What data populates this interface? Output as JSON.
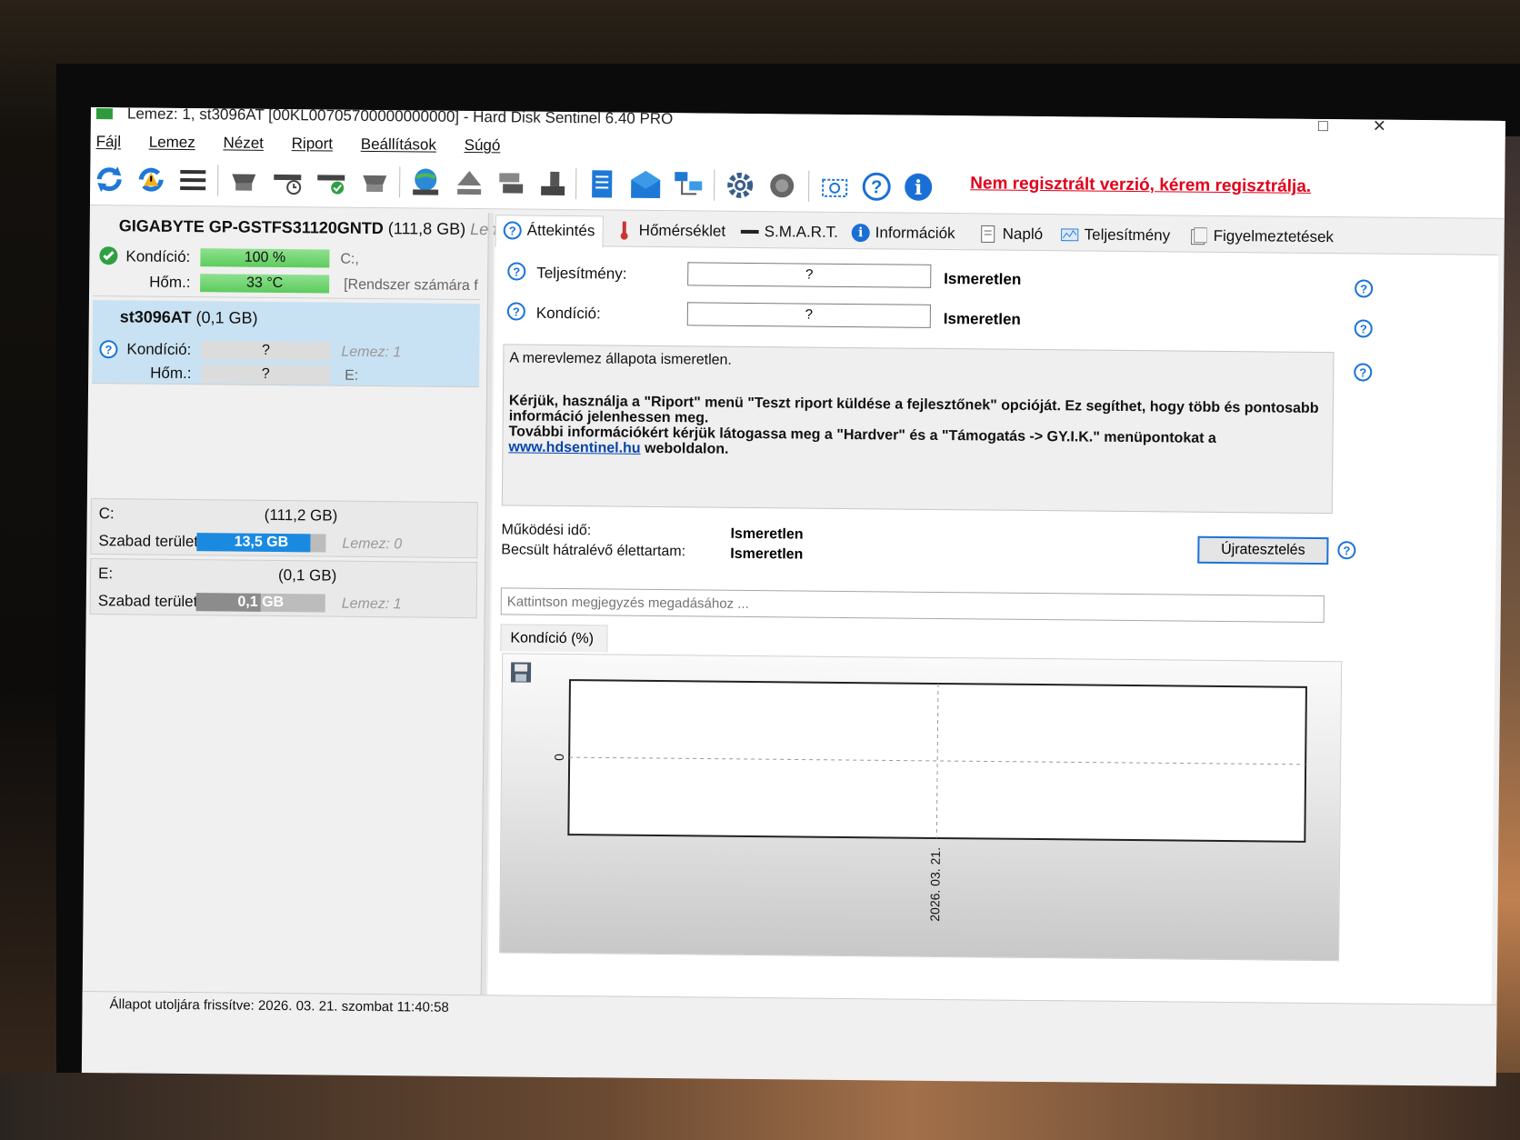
{
  "window": {
    "title": "Lemez: 1, st3096AT [00KL00705700000000000] - Hard Disk Sentinel 6.40 PRO",
    "minimize_glyph": "–",
    "maximize_glyph": "□",
    "close_glyph": "✕"
  },
  "menu": [
    "Fájl",
    "Lemez",
    "Nézet",
    "Riport",
    "Beállítások",
    "Súgó"
  ],
  "toolbar": {
    "icons": [
      "refresh-icon",
      "refresh-warning-icon",
      "disk-list-icon",
      "disk-icon",
      "disk-time-icon",
      "disk-ok-icon",
      "disk-remove-icon",
      "globe-disk-icon",
      "eject-icon",
      "network-disk-icon",
      "usb-disk-icon",
      "report-icon",
      "mail-icon",
      "network-icon",
      "settings-icon",
      "speaker-icon",
      "screenshot-icon",
      "help-icon",
      "info-icon"
    ],
    "nag_text": "Nem regisztrált verzió, kérem regisztrálja."
  },
  "disks": [
    {
      "name": "GIGABYTE GP-GSTFS31120GNTD",
      "size": "(111,8 GB)",
      "extra": "Lemez",
      "health_label": "Kondíció:",
      "health_value": "100 %",
      "health_percent": 100,
      "health_note": "C:,",
      "temp_label": "Hőm.:",
      "temp_value": "33 °C",
      "temp_note": "[Rendszer számára f",
      "status_icon": "check-icon"
    },
    {
      "name": "st3096AT",
      "size": "(0,1 GB)",
      "health_label": "Kondíció:",
      "health_value": "?",
      "health_note": "Lemez: 1",
      "temp_label": "Hőm.:",
      "temp_value": "?",
      "temp_note": "E:",
      "status_icon": "question-icon"
    }
  ],
  "volumes": [
    {
      "letter": "C:",
      "size": "(111,2 GB)",
      "free_label": "Szabad terület",
      "free_value": "13,5 GB",
      "free_fraction": 0.88,
      "disk_note": "Lemez: 0",
      "bar_color": "#1a8ae0"
    },
    {
      "letter": "E:",
      "size": "(0,1 GB)",
      "free_label": "Szabad terület",
      "free_value": "0,1 GB",
      "free_fraction": 0.5,
      "disk_note": "Lemez: 1",
      "bar_color": "#8c8c8c"
    }
  ],
  "tabs": [
    {
      "label": "Áttekintés",
      "icon": "question-icon"
    },
    {
      "label": "Hőmérséklet",
      "icon": "thermometer-icon"
    },
    {
      "label": "S.M.A.R.T.",
      "icon": "disk-small-icon"
    },
    {
      "label": "Információk",
      "icon": "info-icon"
    },
    {
      "label": "Napló",
      "icon": "log-icon"
    },
    {
      "label": "Teljesítmény",
      "icon": "performance-icon"
    },
    {
      "label": "Figyelmeztetések",
      "icon": "alerts-icon"
    }
  ],
  "overview": {
    "performance_label": "Teljesítmény:",
    "performance_meter": "?",
    "performance_value": "Ismeretlen",
    "health_label": "Kondíció:",
    "health_meter": "?",
    "health_value": "Ismeretlen",
    "status_line1": "A merevlemez állapota ismeretlen.",
    "status_line2": "Kérjük, használja a \"Riport\" menü \"Teszt riport küldése a fejlesztőnek\" opcióját. Ez segíthet, hogy több és pontosabb információ jelenhessen meg.",
    "status_line3": "További információkért kérjük látogassa meg a \"Hardver\" és a \"Támogatás -> GY.I.K.\" menüpontokat a",
    "status_link": "www.hdsentinel.hu",
    "status_line3_end": "weboldalon.",
    "uptime_label": "Működési idő:",
    "uptime_value": "Ismeretlen",
    "lifetime_label": "Becsült hátralévő élettartam:",
    "lifetime_value": "Ismeretlen",
    "retest_label": "Újratesztelés",
    "note_placeholder": "Kattintson megjegyzés megadásához ..."
  },
  "chart_data": {
    "type": "line",
    "title": "Kondíció  (%)",
    "x": [
      "2026. 03. 21."
    ],
    "series": [
      {
        "values": [
          0
        ]
      }
    ],
    "ytick_labels": [
      "0"
    ],
    "grid": true
  },
  "statusbar": {
    "text": "Állapot utoljára frissítve: 2026. 03. 21. szombat 11:40:58"
  }
}
